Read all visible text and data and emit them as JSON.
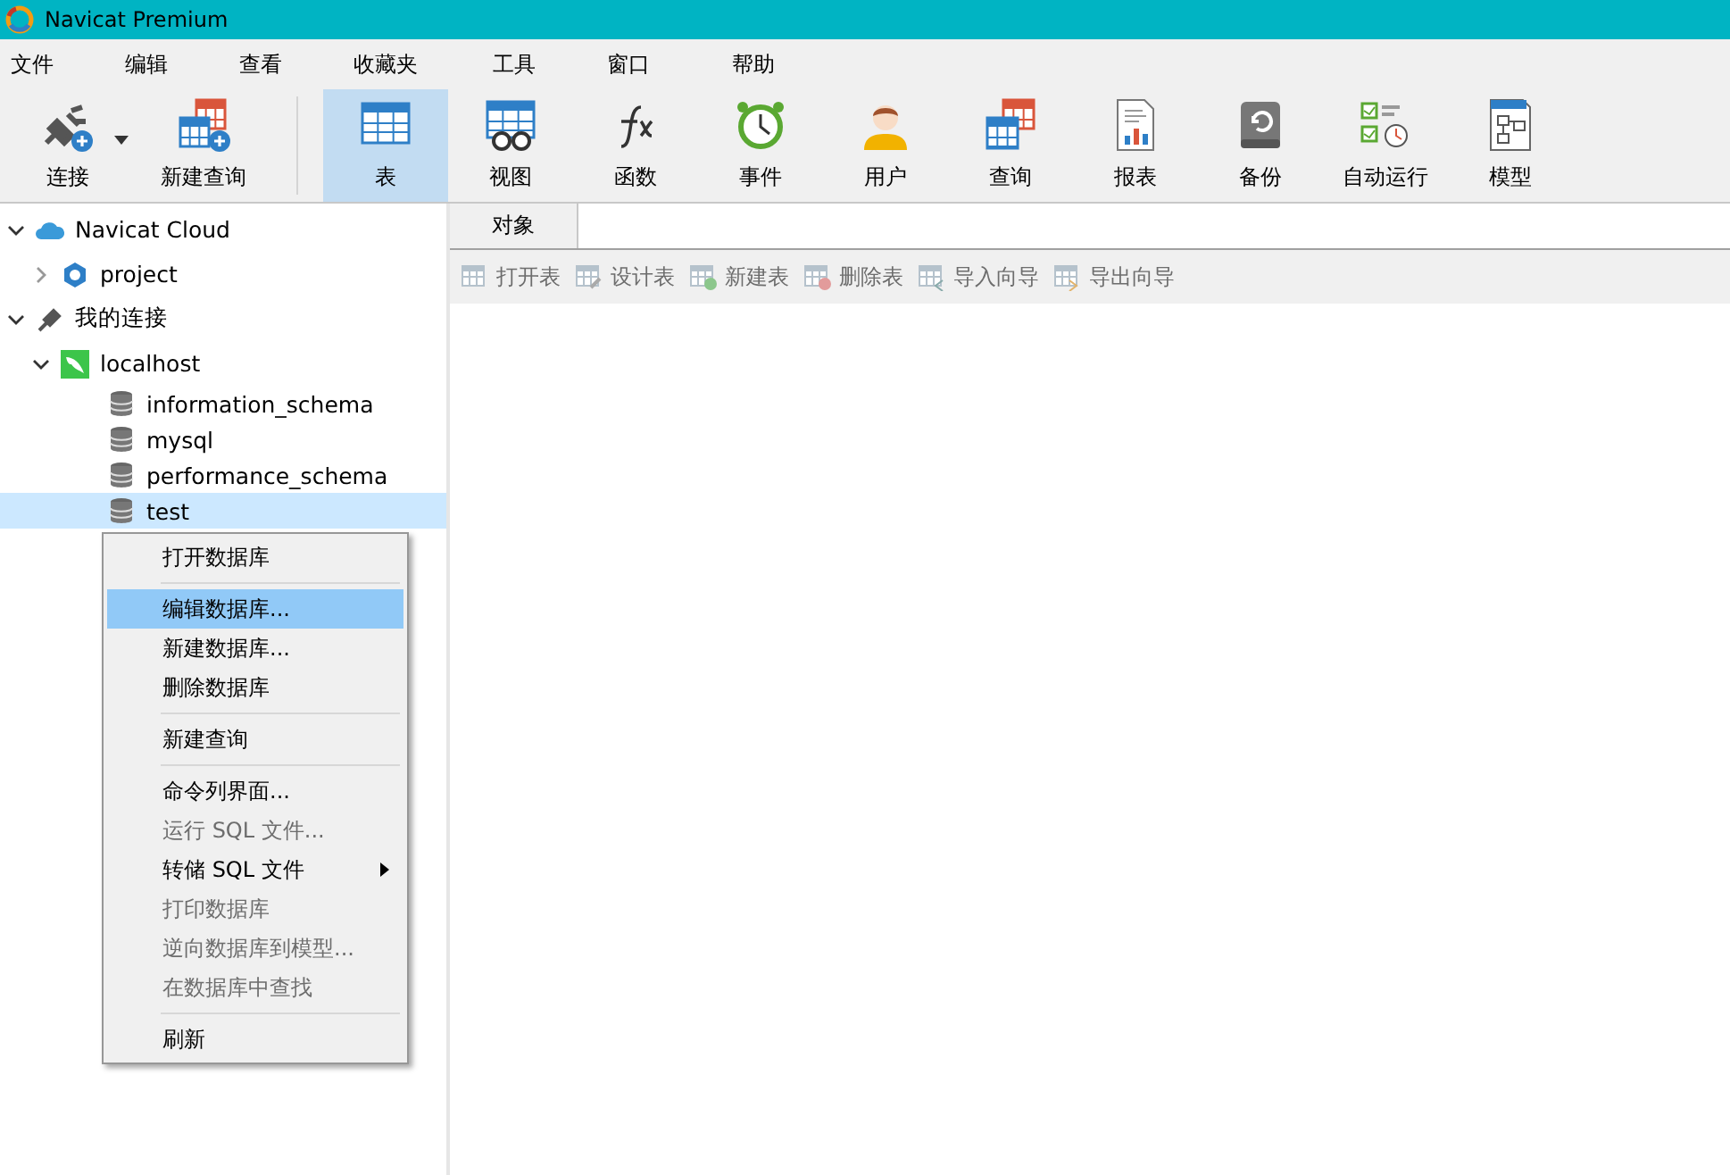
{
  "window": {
    "title": "Navicat Premium"
  },
  "menu": [
    "文件",
    "编辑",
    "查看",
    "收藏夹",
    "工具",
    "窗口",
    "帮助"
  ],
  "toolbar": [
    {
      "label": "连接",
      "kind": "connect",
      "selected": false,
      "dropdown": true
    },
    {
      "label": "新建查询",
      "kind": "newquery",
      "selected": false,
      "dropdown": false
    },
    {
      "label": "表",
      "kind": "table",
      "selected": true,
      "dropdown": false
    },
    {
      "label": "视图",
      "kind": "view",
      "selected": false,
      "dropdown": false
    },
    {
      "label": "函数",
      "kind": "function",
      "selected": false,
      "dropdown": false
    },
    {
      "label": "事件",
      "kind": "event",
      "selected": false,
      "dropdown": false
    },
    {
      "label": "用户",
      "kind": "user",
      "selected": false,
      "dropdown": false
    },
    {
      "label": "查询",
      "kind": "query",
      "selected": false,
      "dropdown": false
    },
    {
      "label": "报表",
      "kind": "report",
      "selected": false,
      "dropdown": false
    },
    {
      "label": "备份",
      "kind": "backup",
      "selected": false,
      "dropdown": false
    },
    {
      "label": "自动运行",
      "kind": "schedule",
      "selected": false,
      "dropdown": false
    },
    {
      "label": "模型",
      "kind": "model",
      "selected": false,
      "dropdown": false
    }
  ],
  "tree": [
    {
      "label": "Navicat Cloud",
      "kind": "cloud",
      "expanded": true,
      "selected": false,
      "children": [
        {
          "label": "project",
          "kind": "project",
          "expanded": false,
          "selected": false
        }
      ]
    },
    {
      "label": "我的连接",
      "kind": "connections",
      "expanded": true,
      "selected": false,
      "children": [
        {
          "label": "localhost",
          "kind": "mysql",
          "expanded": true,
          "selected": false,
          "children": [
            {
              "label": "information_schema",
              "kind": "database",
              "selected": false
            },
            {
              "label": "mysql",
              "kind": "database",
              "selected": false
            },
            {
              "label": "performance_schema",
              "kind": "database",
              "selected": false
            },
            {
              "label": "test",
              "kind": "database",
              "selected": true
            }
          ]
        }
      ]
    }
  ],
  "tabs": [
    {
      "label": "对象",
      "selected": true
    }
  ],
  "object_toolbar": [
    {
      "label": "打开表",
      "kind": "open",
      "disabled": true
    },
    {
      "label": "设计表",
      "kind": "design",
      "disabled": true
    },
    {
      "label": "新建表",
      "kind": "new",
      "disabled": true
    },
    {
      "label": "删除表",
      "kind": "delete",
      "disabled": true
    },
    {
      "label": "导入向导",
      "kind": "import",
      "disabled": true
    },
    {
      "label": "导出向导",
      "kind": "export",
      "disabled": true
    }
  ],
  "context_menu": [
    [
      {
        "label": "打开数据库",
        "disabled": false,
        "selected": false,
        "submenu": false
      }
    ],
    [
      {
        "label": "编辑数据库...",
        "disabled": false,
        "selected": true,
        "submenu": false
      },
      {
        "label": "新建数据库...",
        "disabled": false,
        "selected": false,
        "submenu": false
      },
      {
        "label": "删除数据库",
        "disabled": false,
        "selected": false,
        "submenu": false
      }
    ],
    [
      {
        "label": "新建查询",
        "disabled": false,
        "selected": false,
        "submenu": false
      }
    ],
    [
      {
        "label": "命令列界面...",
        "disabled": false,
        "selected": false,
        "submenu": false
      },
      {
        "label": "运行 SQL 文件...",
        "disabled": true,
        "selected": false,
        "submenu": false
      },
      {
        "label": "转储 SQL 文件",
        "disabled": false,
        "selected": false,
        "submenu": true
      },
      {
        "label": "打印数据库",
        "disabled": true,
        "selected": false,
        "submenu": false
      },
      {
        "label": "逆向数据库到模型...",
        "disabled": true,
        "selected": false,
        "submenu": false
      },
      {
        "label": "在数据库中查找",
        "disabled": true,
        "selected": false,
        "submenu": false
      }
    ],
    [
      {
        "label": "刷新",
        "disabled": false,
        "selected": false,
        "submenu": false
      }
    ]
  ]
}
